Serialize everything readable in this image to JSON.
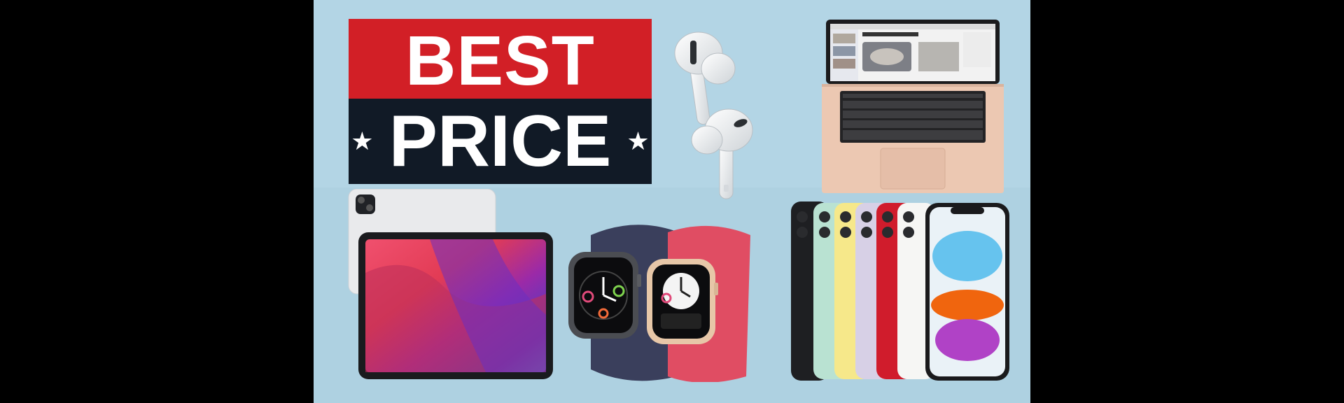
{
  "badge": {
    "line1": "BEST",
    "line2": "PRICE",
    "star": "★",
    "colors": {
      "top": "#d21f26",
      "bottom": "#111a26",
      "text": "#ffffff"
    }
  },
  "background": {
    "color": "#b3d5e5",
    "side_bars": "#000000"
  },
  "products": [
    {
      "name": "airpods-pro"
    },
    {
      "name": "macbook-air-gold"
    },
    {
      "name": "ipad-pro"
    },
    {
      "name": "apple-watch-pair"
    },
    {
      "name": "iphone-11-lineup"
    }
  ]
}
